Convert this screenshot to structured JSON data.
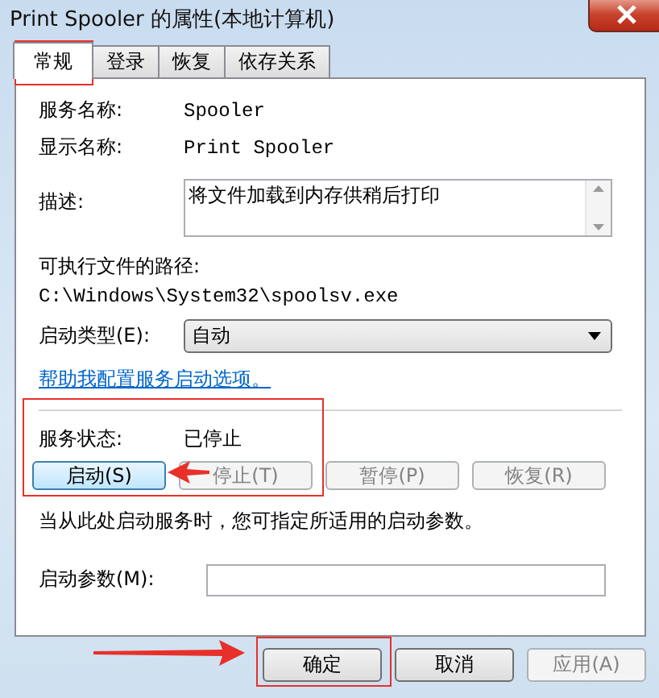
{
  "window": {
    "title": "Print Spooler 的属性(本地计算机)"
  },
  "tabs": [
    {
      "label": "常规",
      "selected": true
    },
    {
      "label": "登录",
      "selected": false
    },
    {
      "label": "恢复",
      "selected": false
    },
    {
      "label": "依存关系",
      "selected": false
    }
  ],
  "fields": [
    {
      "kind": "info",
      "label": "服务名称:",
      "value": "Spooler"
    },
    {
      "kind": "info",
      "label": "显示名称:",
      "value": "Print Spooler"
    },
    {
      "kind": "textarea",
      "label": "描述:",
      "value": "将文件加载到内存供稍后打印"
    }
  ],
  "path": {
    "label": "可执行文件的路径:",
    "value": "C:\\Windows\\System32\\spoolsv.exe"
  },
  "startup_type": {
    "label": "启动类型(E):",
    "value": "自动"
  },
  "help_link": "帮助我配置服务启动选项。",
  "status": {
    "label": "服务状态:",
    "value": "已停止"
  },
  "service_buttons": [
    {
      "label": "启动(S)",
      "disabled": false
    },
    {
      "label": "停止(T)",
      "disabled": true
    },
    {
      "label": "暂停(P)",
      "disabled": true
    },
    {
      "label": "恢复(R)",
      "disabled": true
    }
  ],
  "hint": "当从此处启动服务时，您可指定所适用的启动参数。",
  "start_params": {
    "label": "启动参数(M):"
  },
  "dialog_buttons": [
    {
      "label": "确定",
      "disabled": false
    },
    {
      "label": "取消",
      "disabled": false
    },
    {
      "label": "应用(A)",
      "disabled": true
    }
  ]
}
